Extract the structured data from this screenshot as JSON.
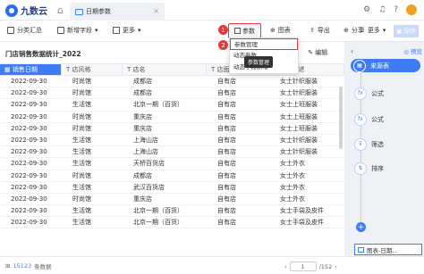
{
  "app": {
    "name": "九数云"
  },
  "tab": {
    "label": "日期参数",
    "close": "×"
  },
  "titlebar": {
    "icons": [
      "gear-icon",
      "bell-icon",
      "help-icon"
    ]
  },
  "toolbar": {
    "classify": "分类汇总",
    "new_field": "新增字段",
    "more": "更多",
    "param": "参数",
    "chart": "图表",
    "export": "导出",
    "share": "分享",
    "more2": "更多",
    "save": "保存",
    "badge1": "1",
    "badge2": "2"
  },
  "table": {
    "title": "门店销售数据统计_2022",
    "switch": "切换",
    "edit": "编辑",
    "columns": [
      "销售日期",
      "店风格",
      "店名",
      "店面",
      "品类描述"
    ],
    "rows": [
      [
        "2022-09-30",
        "时尚馆",
        "成都店",
        "自有店",
        "女士针织服装"
      ],
      [
        "2022-09-30",
        "时尚馆",
        "成都店",
        "自有店",
        "女士针织服装"
      ],
      [
        "2022-09-30",
        "生活馆",
        "北京一期（百货）",
        "自有店",
        "女士上班服装"
      ],
      [
        "2022-09-30",
        "时尚馆",
        "重庆店",
        "自有店",
        "女士上班服装"
      ],
      [
        "2022-09-30",
        "时尚馆",
        "重庆店",
        "自有店",
        "女士上班服装"
      ],
      [
        "2022-09-30",
        "生活馆",
        "上海山店",
        "自有店",
        "女士针织服装"
      ],
      [
        "2022-09-30",
        "生活馆",
        "上海山店",
        "自有店",
        "女士针织服装"
      ],
      [
        "2022-09-30",
        "生活馆",
        "天桥百货店",
        "自有店",
        "女士外衣"
      ],
      [
        "2022-09-30",
        "时尚馆",
        "成都店",
        "自有店",
        "女士外衣"
      ],
      [
        "2022-09-30",
        "生活馆",
        "武汉百货店",
        "自有店",
        "女士外衣"
      ],
      [
        "2022-09-30",
        "时尚馆",
        "重庆店",
        "自有店",
        "女士外衣"
      ],
      [
        "2022-09-30",
        "生活馆",
        "北京一期（百货）",
        "自有店",
        "女士手袋及皮件"
      ],
      [
        "2022-09-30",
        "生活馆",
        "北京一期（百货）",
        "自有店",
        "女士手袋及皮件"
      ]
    ]
  },
  "dropdown": {
    "items": [
      "参数管理",
      "动态参数",
      "动态字段新增"
    ],
    "tooltip": "参数管理"
  },
  "footer": {
    "count": "15123",
    "count_label": "条数据",
    "page": "1",
    "page_total": "/152"
  },
  "pipeline": {
    "preview": "预览",
    "nodes": [
      {
        "label": "来源表",
        "icon": "▦"
      },
      {
        "label": "公式",
        "icon": "fx"
      },
      {
        "label": "公式",
        "icon": "fx"
      },
      {
        "label": "筛选",
        "icon": "⊽"
      },
      {
        "label": "排序",
        "icon": "⇅"
      }
    ],
    "add": "+",
    "result": "图表-日期..."
  },
  "colors": {
    "accent": "#3d7cf5",
    "highlight": "#e03a3a"
  }
}
